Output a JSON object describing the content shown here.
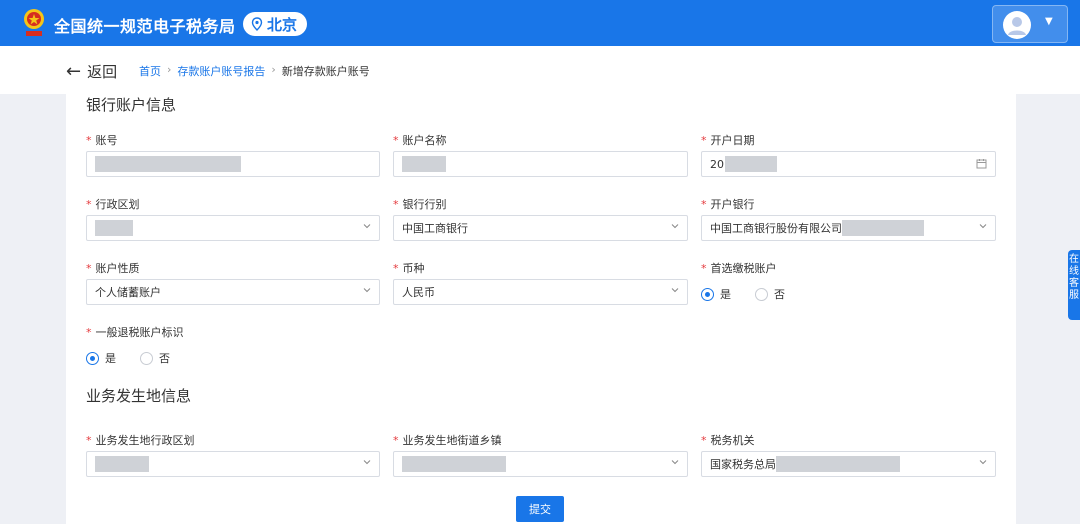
{
  "header": {
    "app_title": "全国统一规范电子税务局",
    "city": "北京",
    "logo_text": "中国税务"
  },
  "nav": {
    "back_label": "返回",
    "breadcrumb": [
      "首页",
      "存款账户账号报告",
      "新增存款账户账号"
    ]
  },
  "sections": {
    "bank_info": "银行账户信息",
    "business_location": "业务发生地信息"
  },
  "fields": {
    "account_no": {
      "label": "账号",
      "value": ""
    },
    "account_name": {
      "label": "账户名称",
      "value": ""
    },
    "open_date": {
      "label": "开户日期",
      "value": "20"
    },
    "admin_region": {
      "label": "行政区划",
      "value": ""
    },
    "bank_type": {
      "label": "银行行别",
      "value": "中国工商银行"
    },
    "open_bank": {
      "label": "开户银行",
      "value": "中国工商银行股份有限公司"
    },
    "account_nature": {
      "label": "账户性质",
      "value": "个人储蓄账户"
    },
    "currency": {
      "label": "币种",
      "value": "人民币"
    },
    "preferred_tax_account": {
      "label": "首选缴税账户",
      "options": [
        "是",
        "否"
      ],
      "selected": "是"
    },
    "refund_account_flag": {
      "label": "一般退税账户标识",
      "options": [
        "是",
        "否"
      ],
      "selected": "是"
    },
    "biz_admin_region": {
      "label": "业务发生地行政区划",
      "value": ""
    },
    "biz_street": {
      "label": "业务发生地街道乡镇",
      "value": ""
    },
    "tax_authority": {
      "label": "税务机关",
      "value": "国家税务总局"
    }
  },
  "actions": {
    "submit_label": "提交"
  },
  "side_tab": {
    "text": "在线客服"
  },
  "colors": {
    "primary": "#1976e8",
    "required": "#e4393c"
  }
}
